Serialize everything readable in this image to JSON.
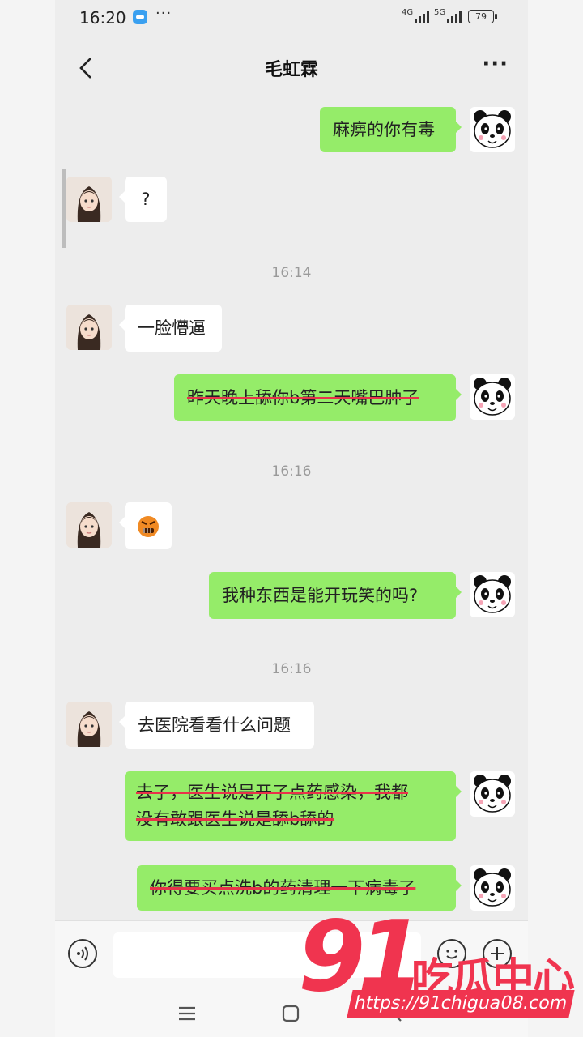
{
  "status_bar": {
    "time": "16:20",
    "network_1": "4G",
    "network_2": "5G",
    "battery": "79"
  },
  "header": {
    "title": "毛虹霖"
  },
  "messages": [
    {
      "side": "out",
      "text": "麻痹的你有毒"
    },
    {
      "side": "in",
      "text": "?"
    },
    {
      "timestamp": "16:14"
    },
    {
      "side": "in",
      "text": "一脸懵逼"
    },
    {
      "side": "out",
      "text": "昨天晚上舔你b第二天嘴巴肿了",
      "strikethrough": true
    },
    {
      "timestamp": "16:16"
    },
    {
      "side": "in",
      "sticker": "angry-face-sticker"
    },
    {
      "side": "out",
      "text": "我种东西是能开玩笑的吗?"
    },
    {
      "timestamp": "16:16"
    },
    {
      "side": "in",
      "text": "去医院看看什么问题"
    },
    {
      "side": "out",
      "text_lines": [
        "去了，医生说是开了点药感染，我都",
        "没有敢跟医生说是舔b舔的"
      ],
      "strikethrough": true
    },
    {
      "side": "out",
      "text": "你得要买点洗b的药清理一下病毒了",
      "strikethrough": true
    }
  ],
  "watermark": {
    "number": "91",
    "name": "吃瓜中心",
    "url": "https://91chigua08.com"
  },
  "colors": {
    "outgoing_bubble": "#95ec69",
    "incoming_bubble": "#ffffff",
    "background": "#ededed",
    "watermark": "#f0344f",
    "strike": "#e8334a"
  }
}
